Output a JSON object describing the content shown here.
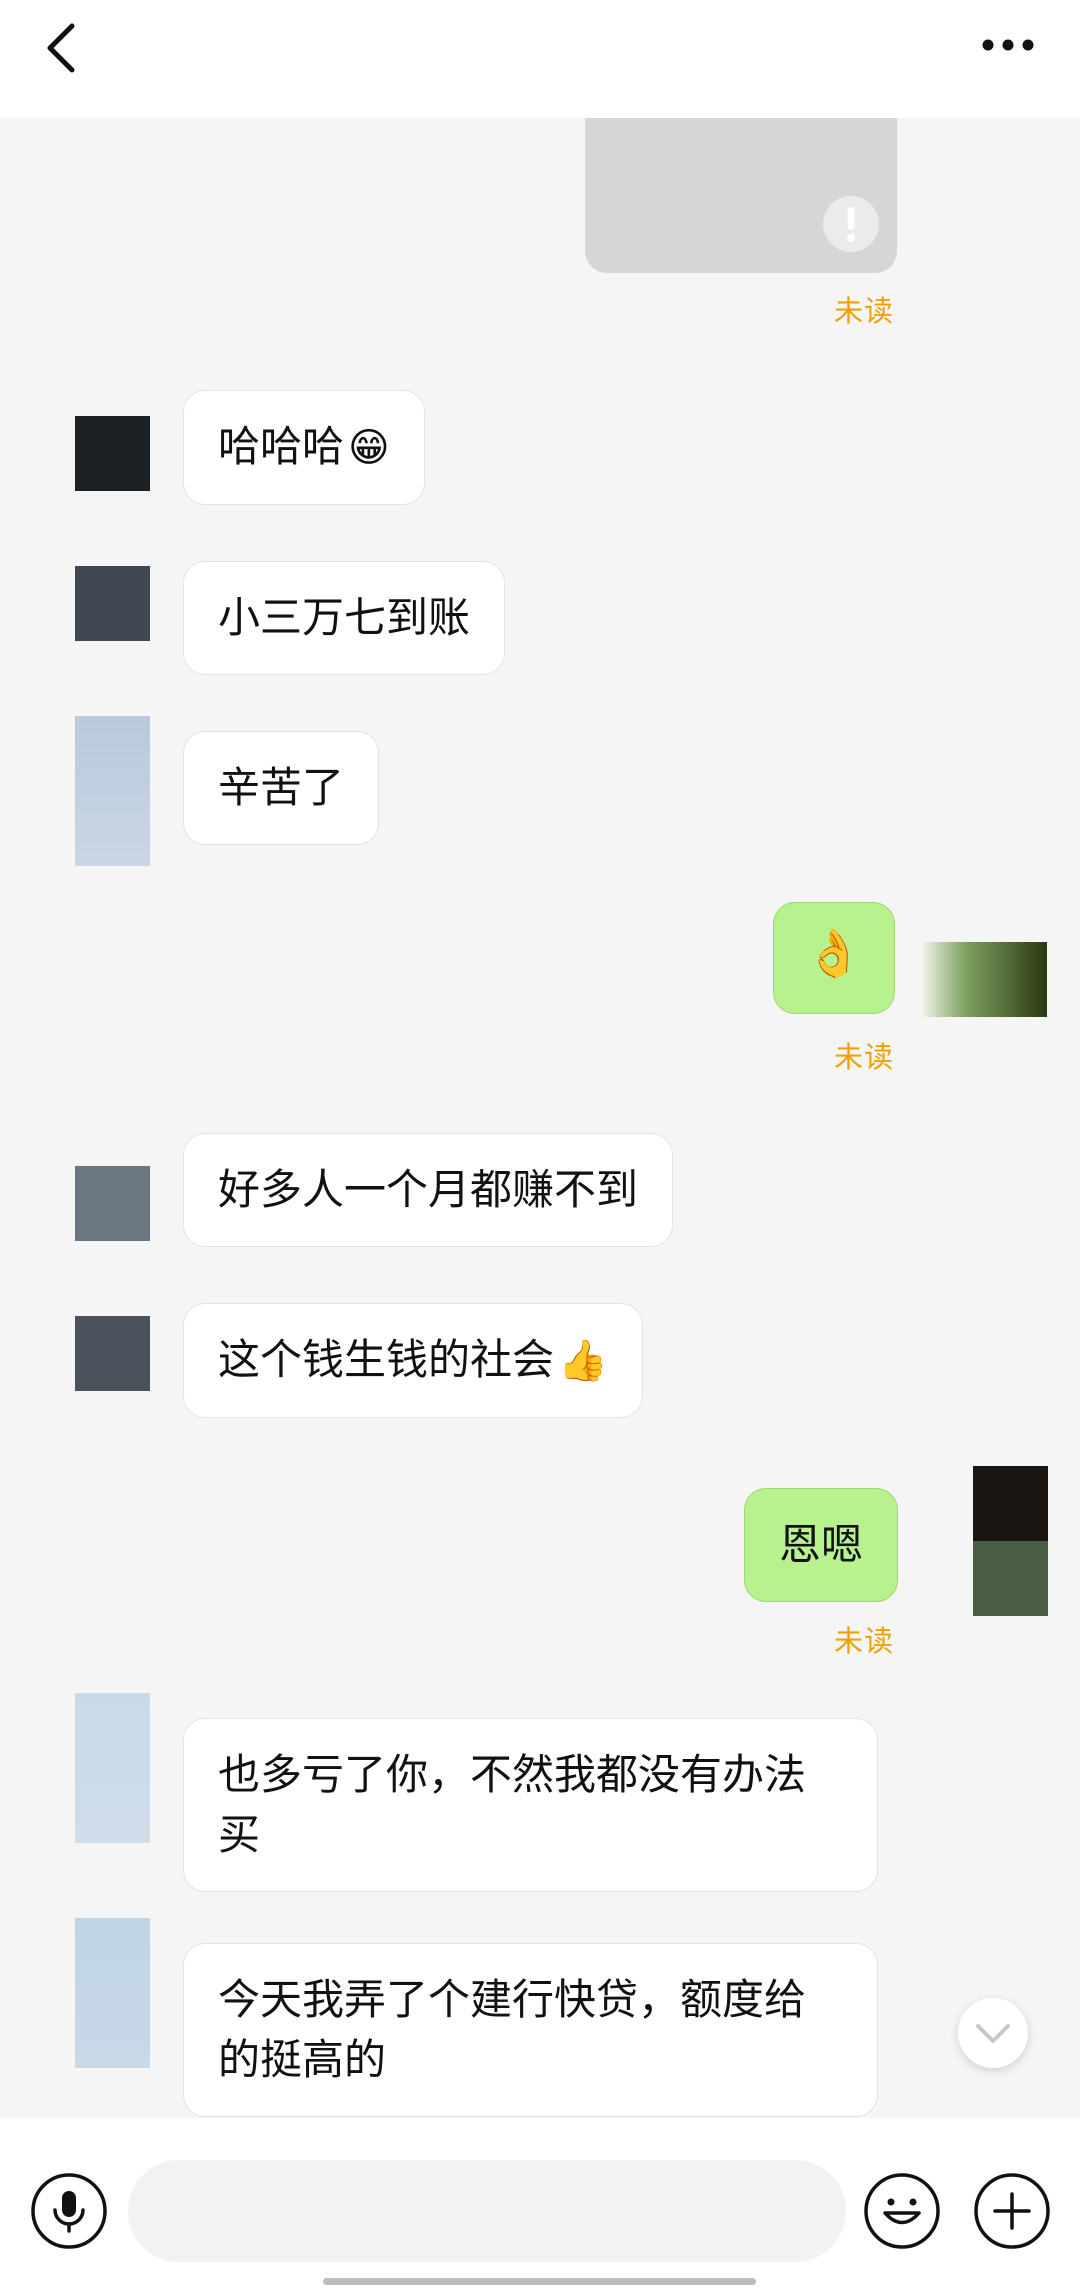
{
  "header": {
    "back_icon": "chevron-left-icon",
    "more_icon": "more-dots-icon"
  },
  "messages": [
    {
      "from": "me",
      "type": "image",
      "status": "未读",
      "icon": "exclamation-circle-icon"
    },
    {
      "from": "them",
      "text": "哈哈哈",
      "emoji": "😁"
    },
    {
      "from": "them",
      "text": "小三万七到账"
    },
    {
      "from": "them",
      "text": "辛苦了"
    },
    {
      "from": "me",
      "text": "",
      "emoji": "👌",
      "status": "未读"
    },
    {
      "from": "them",
      "text": "好多人一个月都赚不到"
    },
    {
      "from": "them",
      "text": "这个钱生钱的社会",
      "emoji": "👍"
    },
    {
      "from": "me",
      "text": "恩嗯",
      "status": "未读"
    },
    {
      "from": "them",
      "text": "也多亏了你，不然我都没有办法买"
    },
    {
      "from": "them",
      "text": "今天我弄了个建行快贷，额度给的挺高的"
    }
  ],
  "input_bar": {
    "voice_icon": "microphone-icon",
    "emoji_icon": "smiley-icon",
    "plus_icon": "plus-icon",
    "text_value": ""
  },
  "colors": {
    "my_bubble": "#b7f28f",
    "their_bubble": "#ffffff",
    "unread": "#f0a000",
    "background": "#f5f5f5"
  }
}
